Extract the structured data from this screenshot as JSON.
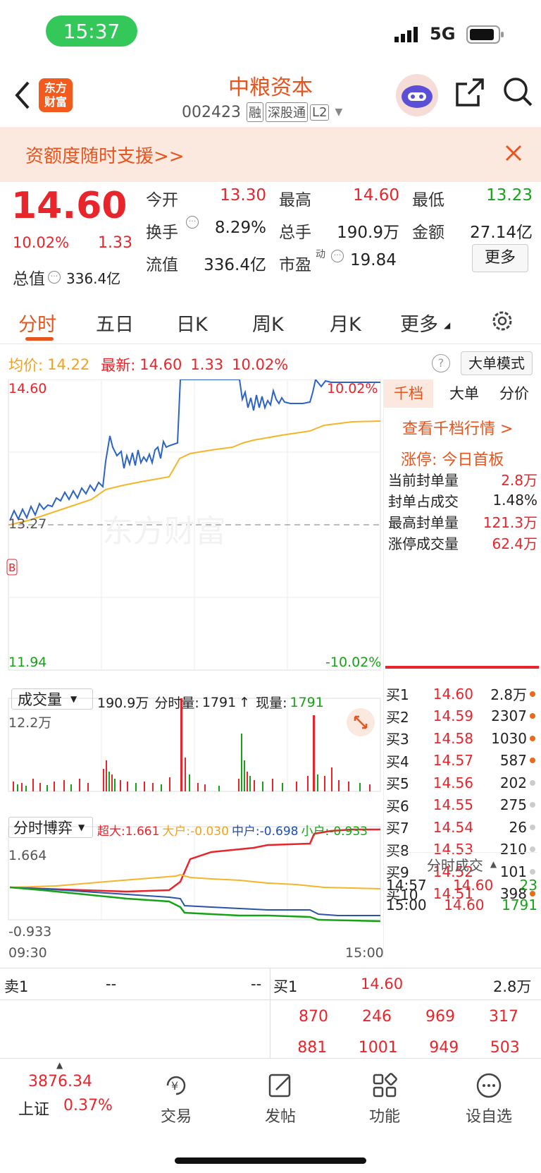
{
  "status": {
    "time": "15:37",
    "network": "5G"
  },
  "header": {
    "logo_text": "东方\n财富",
    "stock_name": "中粮资本",
    "stock_code": "002423",
    "badges": [
      "融",
      "深股通",
      "L2"
    ]
  },
  "promo": {
    "text": "资额度随时支援>>"
  },
  "quote": {
    "price": "14.60",
    "change_pct": "10.02%",
    "change": "1.33",
    "open_label": "今开",
    "open": "13.30",
    "high_label": "最高",
    "high": "14.60",
    "low_label": "最低",
    "low": "13.23",
    "turnover_label": "换手",
    "turnover": "8.29%",
    "volume_label": "总手",
    "volume": "190.9万",
    "amount_label": "金额",
    "amount": "27.14亿",
    "mktcap_label": "总值",
    "mktcap": "336.4亿",
    "float_label": "流值",
    "float": "336.4亿",
    "pe_label": "市盈",
    "pe_sup": "动",
    "pe": "19.84",
    "more_button": "更多"
  },
  "tabs": [
    "分时",
    "五日",
    "日K",
    "周K",
    "月K",
    "更多"
  ],
  "info_bar": {
    "avg_label": "均价:",
    "avg": "14.22",
    "latest_label": "最新:",
    "latest": "14.60",
    "chg": "1.33",
    "pct": "10.02%",
    "mode_button": "大单模式"
  },
  "price_chart": {
    "y_top": "14.60",
    "y_mid": "13.27",
    "y_bottom": "11.94",
    "pct_top": "10.02%",
    "pct_bottom": "-10.02%",
    "watermark": "东方财富",
    "marker": "B"
  },
  "side_tabs": [
    "千档",
    "大单",
    "分价"
  ],
  "side_panel": {
    "link": "查看千档行情 >",
    "limit_title": "涨停: 今日首板",
    "stats": [
      {
        "label": "当前封单量",
        "value": "2.8万"
      },
      {
        "label": "封单占成交",
        "value": "1.48%"
      },
      {
        "label": "最高封单量",
        "value": "121.3万"
      },
      {
        "label": "涨停成交量",
        "value": "62.4万"
      }
    ]
  },
  "order_book": [
    {
      "label": "买1",
      "price": "14.60",
      "vol": "2.8万",
      "dot": "#e86a1b"
    },
    {
      "label": "买2",
      "price": "14.59",
      "vol": "2307",
      "dot": "#e86a1b"
    },
    {
      "label": "买3",
      "price": "14.58",
      "vol": "1030",
      "dot": "#e86a1b"
    },
    {
      "label": "买4",
      "price": "14.57",
      "vol": "587",
      "dot": "#e86a1b"
    },
    {
      "label": "买5",
      "price": "14.56",
      "vol": "202",
      "dot": "#cccccc"
    },
    {
      "label": "买6",
      "price": "14.55",
      "vol": "275",
      "dot": "#cccccc"
    },
    {
      "label": "买7",
      "price": "14.54",
      "vol": "26",
      "dot": "#cccccc"
    },
    {
      "label": "买8",
      "price": "14.53",
      "vol": "210",
      "dot": "#cccccc"
    },
    {
      "label": "买9",
      "price": "14.52",
      "vol": "101",
      "dot": "#cccccc"
    },
    {
      "label": "买10",
      "price": "14.51",
      "vol": "398",
      "dot": "#e86a1b"
    }
  ],
  "ticks": {
    "title": "分时成交",
    "rows": [
      {
        "time": "14:57",
        "price": "14.60",
        "vol": "23"
      },
      {
        "time": "15:00",
        "price": "14.60",
        "vol": "1791"
      }
    ]
  },
  "volume_chart": {
    "dropdown": "成交量",
    "summary": "190.9万",
    "tick_label": "分时量:",
    "tick_val": "1791",
    "arrow": "↑",
    "now_label": "现量:",
    "now_val": "1791",
    "y_top": "12.2万"
  },
  "flow_chart": {
    "dropdown": "分时博弈",
    "super": "超大:1.661",
    "big": "大户:-0.030",
    "mid": "中户:-0.698",
    "small": "小户:-0.933",
    "y_top": "1.664",
    "y_bottom": "-0.933",
    "t_start": "09:30",
    "t_end": "15:00"
  },
  "level": {
    "sell1_label": "卖1",
    "sell1_price": "--",
    "sell1_vol": "--",
    "buy1_label": "买1",
    "buy1_price": "14.60",
    "buy1_vol": "2.8万",
    "queue1": [
      "870",
      "246",
      "969",
      "317"
    ],
    "queue2": [
      "881",
      "1001",
      "949",
      "503"
    ]
  },
  "bottom": {
    "index_val": "3876.34",
    "index_name": "上证",
    "index_pct": "0.37%",
    "nav": [
      "交易",
      "发帖",
      "功能",
      "设自选"
    ]
  }
}
